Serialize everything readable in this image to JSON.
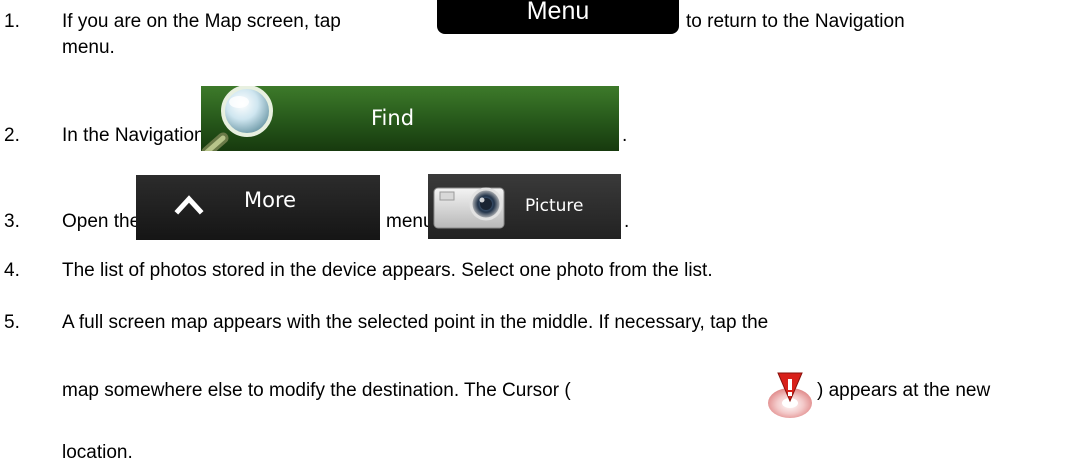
{
  "buttons": {
    "menu": "Menu",
    "find": "Find",
    "more": "More",
    "picture": "Picture"
  },
  "steps": [
    {
      "number": "1.",
      "line1_before": "If you are on the Map screen, tap",
      "line1_after": "to return to the Navigation",
      "line2": "menu."
    },
    {
      "number": "2.",
      "before": "In the Navigation menu, tap",
      "after": "."
    },
    {
      "number": "3.",
      "before": "Open the",
      "middle": "menu and tap",
      "after": "."
    },
    {
      "number": "4.",
      "text": "The list of photos stored in the device appears. Select one photo from the list."
    },
    {
      "number": "5.",
      "line1": "A full screen map appears with the selected point in the middle. If necessary, tap the",
      "line2_before": "map somewhere else to modify the destination. The Cursor (",
      "line2_after": ") appears at the new",
      "line3": "location."
    }
  ],
  "icons": {
    "find": "magnifier-icon",
    "more": "chevron-up-icon",
    "picture": "camera-icon",
    "cursor": "cursor-pin-icon"
  }
}
